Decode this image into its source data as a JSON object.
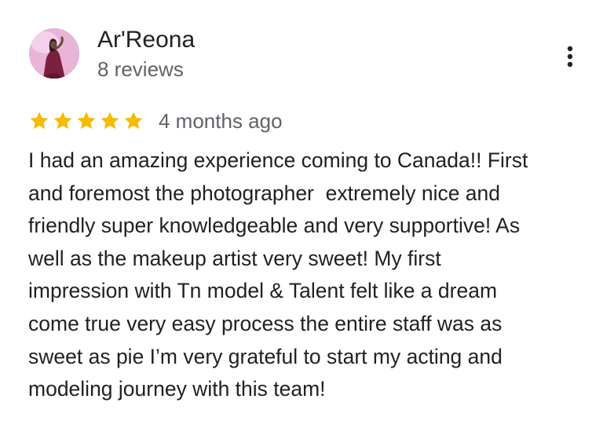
{
  "review": {
    "author_name": "Ar'Reona",
    "author_review_count": "8 reviews",
    "avatar_icon": "user-avatar-photo",
    "menu_icon": "more-vert-icon",
    "rating": 5,
    "rating_max": 5,
    "star_color": "#F6BB06",
    "timestamp": "4 months ago",
    "text_lines": [
      "I had an amazing experience coming to Canada!! First",
      "and foremost the photographer  extremely nice and",
      "friendly super knowledgeable and very supportive! As",
      "well as the makeup artist very sweet! My first",
      "impression with Tn model & Talent felt like a dream",
      "come true very easy process the entire staff was as",
      "sweet as pie I’m very grateful to start my acting and",
      "modeling journey with this team!"
    ]
  }
}
